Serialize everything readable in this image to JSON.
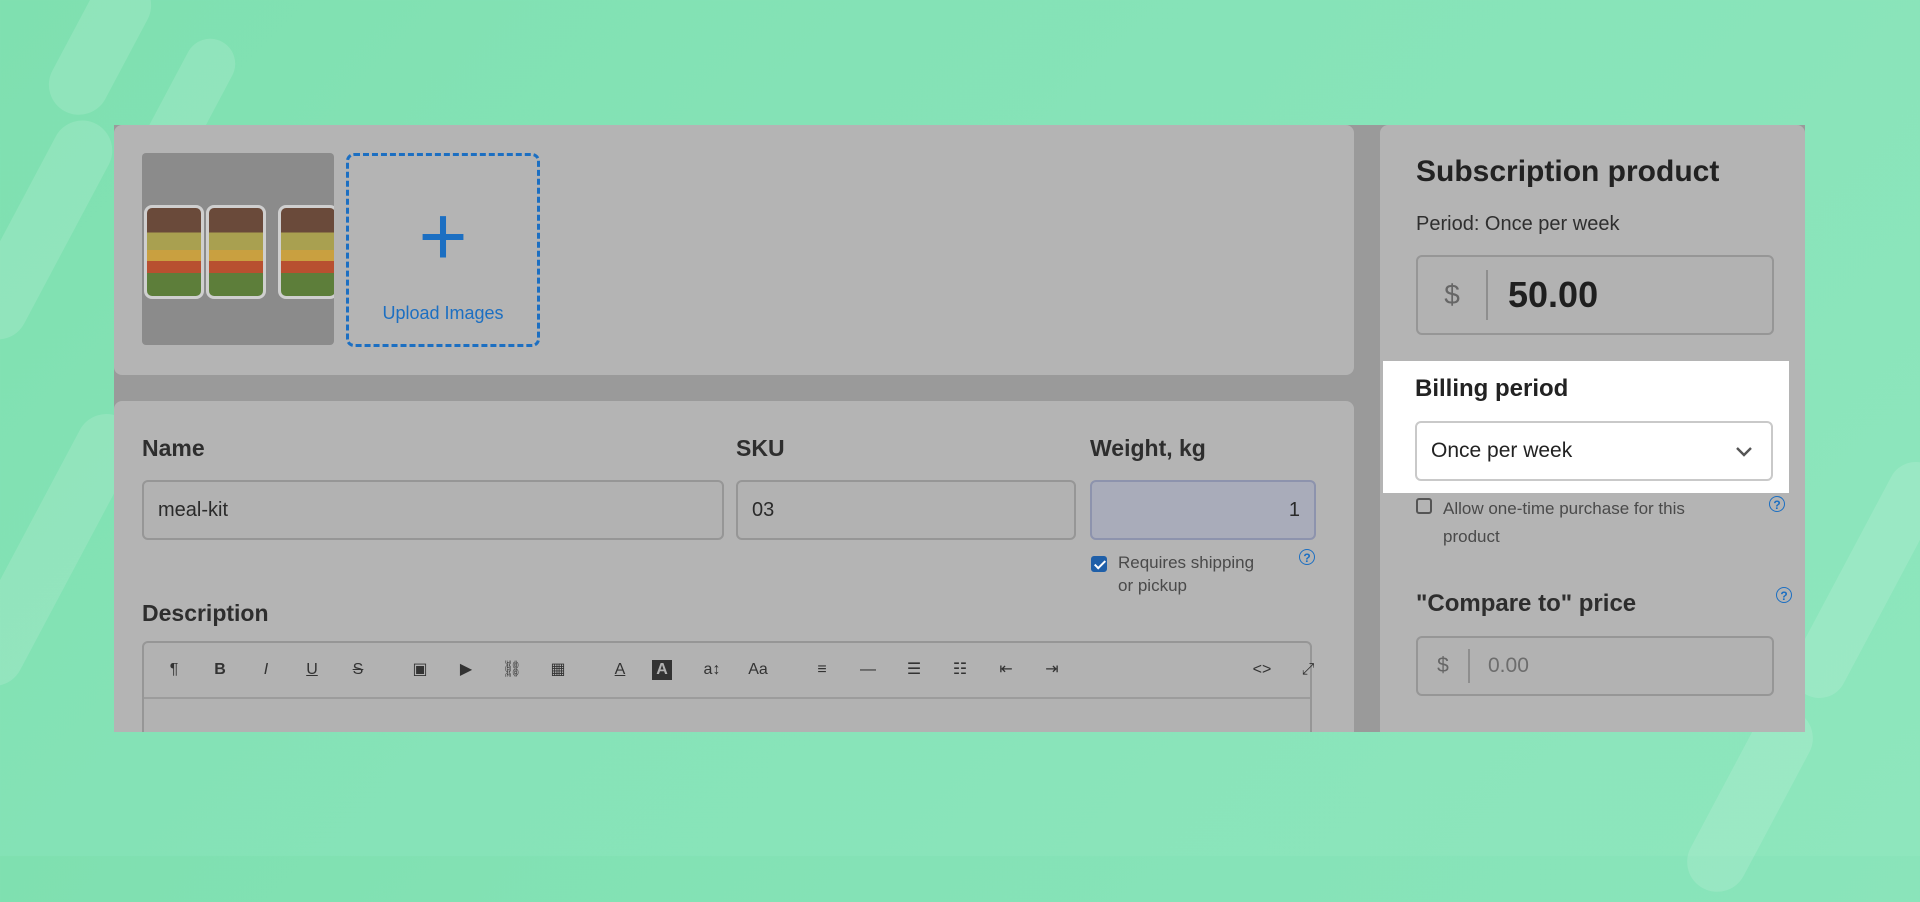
{
  "media": {
    "upload_label": "Upload Images",
    "plus_glyph": "+"
  },
  "form": {
    "name_label": "Name",
    "name_value": "meal-kit",
    "sku_label": "SKU",
    "sku_value": "03",
    "weight_label": "Weight, kg",
    "weight_value": "1",
    "requires_shipping_label": "Requires shipping or pickup",
    "requires_shipping_checked": true,
    "description_label": "Description"
  },
  "editor_toolbar": {
    "buttons": [
      {
        "name": "paragraph-icon",
        "glyph": "¶"
      },
      {
        "name": "bold-icon",
        "glyph": "B"
      },
      {
        "name": "italic-icon",
        "glyph": "I"
      },
      {
        "name": "underline-icon",
        "glyph": "U"
      },
      {
        "name": "strikethrough-icon",
        "glyph": "S"
      },
      {
        "name": "image-icon",
        "glyph": "▣"
      },
      {
        "name": "video-icon",
        "glyph": "▶"
      },
      {
        "name": "link-icon",
        "glyph": "⛓"
      },
      {
        "name": "table-icon",
        "glyph": "▦"
      },
      {
        "name": "font-color-icon",
        "glyph": "A"
      },
      {
        "name": "highlight-color-icon",
        "glyph": "A"
      },
      {
        "name": "font-size-icon",
        "glyph": "a↕"
      },
      {
        "name": "font-family-icon",
        "glyph": "Aa"
      },
      {
        "name": "align-icon",
        "glyph": "≡"
      },
      {
        "name": "horizontal-rule-icon",
        "glyph": "—"
      },
      {
        "name": "bullet-list-icon",
        "glyph": "☰"
      },
      {
        "name": "numbered-list-icon",
        "glyph": "☷"
      },
      {
        "name": "outdent-icon",
        "glyph": "⇤"
      },
      {
        "name": "indent-icon",
        "glyph": "⇥"
      },
      {
        "name": "code-view-icon",
        "glyph": "<>"
      },
      {
        "name": "fullscreen-icon",
        "glyph": "⤢"
      }
    ]
  },
  "subscription": {
    "title": "Subscription product",
    "period_text": "Period: Once per week",
    "currency_symbol": "$",
    "price_value": "50.00",
    "billing_period_label": "Billing period",
    "billing_period_value": "Once per week",
    "one_time_label": "Allow one-time purchase for this product",
    "one_time_checked": false,
    "compare_label": "\"Compare to\" price",
    "compare_placeholder": "0.00",
    "help_glyph": "?"
  },
  "colors": {
    "accent_blue": "#1c6fc2",
    "background_green": "#86e3b8"
  }
}
